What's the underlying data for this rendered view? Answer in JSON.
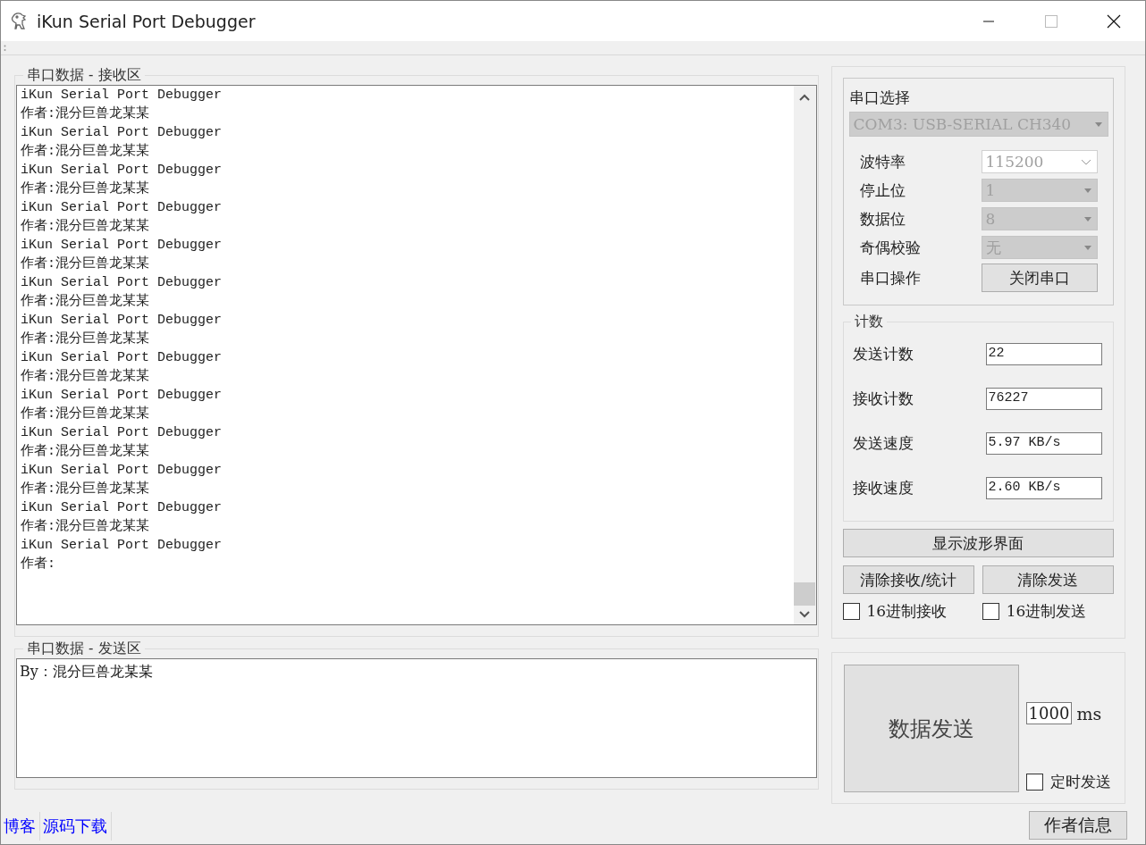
{
  "window": {
    "title": "iKun Serial Port Debugger"
  },
  "receive": {
    "legend": "串口数据 - 接收区",
    "lines": [
      "iKun Serial Port Debugger",
      "作者:混分巨兽龙某某",
      "iKun Serial Port Debugger",
      "作者:混分巨兽龙某某",
      "iKun Serial Port Debugger",
      "作者:混分巨兽龙某某",
      "iKun Serial Port Debugger",
      "作者:混分巨兽龙某某",
      "iKun Serial Port Debugger",
      "作者:混分巨兽龙某某",
      "iKun Serial Port Debugger",
      "作者:混分巨兽龙某某",
      "iKun Serial Port Debugger",
      "作者:混分巨兽龙某某",
      "iKun Serial Port Debugger",
      "作者:混分巨兽龙某某",
      "iKun Serial Port Debugger",
      "作者:混分巨兽龙某某",
      "iKun Serial Port Debugger",
      "作者:混分巨兽龙某某",
      "iKun Serial Port Debugger",
      "作者:混分巨兽龙某某",
      "iKun Serial Port Debugger",
      "作者:混分巨兽龙某某",
      "iKun Serial Port Debugger",
      "作者:"
    ]
  },
  "send": {
    "legend": "串口数据 - 发送区",
    "value": "By：混分巨兽龙某某"
  },
  "links": [
    "博客",
    "源码下载"
  ],
  "port": {
    "title": "串口选择",
    "value": "COM3: USB-SERIAL CH340",
    "disabled": true,
    "settings": [
      {
        "label": "波特率",
        "value": "115200",
        "kind": "editable",
        "disabled": true
      },
      {
        "label": "停止位",
        "value": "1",
        "kind": "dropdown",
        "disabled": true
      },
      {
        "label": "数据位",
        "value": "8",
        "kind": "dropdown",
        "disabled": true
      },
      {
        "label": "奇偶校验",
        "value": "无",
        "kind": "dropdown",
        "disabled": true
      }
    ],
    "operation_label": "串口操作",
    "operation_button": "关闭串口"
  },
  "counts": {
    "legend": "计数",
    "items": [
      {
        "label": "发送计数",
        "value": "22"
      },
      {
        "label": "接收计数",
        "value": "76227"
      },
      {
        "label": "发送速度",
        "value": "5.97 KB/s"
      },
      {
        "label": "接收速度",
        "value": "2.60 KB/s"
      }
    ]
  },
  "wave_button": "显示波形界面",
  "clear_buttons": [
    "清除接收/统计",
    "清除发送"
  ],
  "hex_options": [
    {
      "label": "16进制接收",
      "checked": false
    },
    {
      "label": "16进制发送",
      "checked": false
    }
  ],
  "sender": {
    "button": "数据发送",
    "interval": "1000",
    "unit": "ms",
    "timer": {
      "label": "定时发送",
      "checked": false
    }
  },
  "author_button": "作者信息"
}
